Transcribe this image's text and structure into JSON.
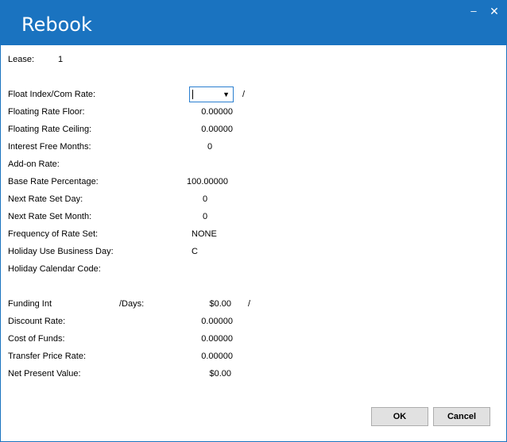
{
  "window": {
    "title": "Rebook",
    "minimize_glyph": "‒",
    "close_glyph": "✕"
  },
  "lease": {
    "label": "Lease:",
    "value": "1"
  },
  "rate_fields": {
    "float_index": {
      "label": "Float Index/Com Rate:",
      "value": "",
      "separator": "/"
    },
    "floor": {
      "label": "Floating Rate Floor:",
      "value": "0.00000"
    },
    "ceiling": {
      "label": "Floating Rate Ceiling:",
      "value": "0.00000"
    },
    "interest_free": {
      "label": "Interest Free Months:",
      "value": "0"
    },
    "add_on": {
      "label": "Add-on Rate:",
      "value": ""
    },
    "base_rate": {
      "label": "Base Rate Percentage:",
      "value": "100.00000"
    },
    "next_set_day": {
      "label": "Next Rate Set Day:",
      "value": "0"
    },
    "next_set_month": {
      "label": "Next Rate Set Month:",
      "value": "0"
    },
    "frequency": {
      "label": "Frequency of Rate Set:",
      "value": "NONE"
    },
    "holiday_bd": {
      "label": "Holiday Use Business Day:",
      "value": "C"
    },
    "holiday_cal": {
      "label": "Holiday Calendar Code:",
      "value": ""
    }
  },
  "funding": {
    "funding_int": {
      "label": "Funding Int",
      "days_label": "/Days:",
      "value": "$0.00",
      "separator": "/"
    },
    "discount": {
      "label": "Discount Rate:",
      "value": "0.00000"
    },
    "cost_of_funds": {
      "label": "Cost of Funds:",
      "value": "0.00000"
    },
    "transfer_price": {
      "label": "Transfer Price Rate:",
      "value": "0.00000"
    },
    "npv": {
      "label": "Net Present Value:",
      "value": "$0.00"
    }
  },
  "buttons": {
    "ok": "OK",
    "cancel": "Cancel"
  },
  "colors": {
    "titlebar": "#1a73c0",
    "button_bg": "#e1e1e1",
    "focus_border": "#2a7fd0"
  }
}
